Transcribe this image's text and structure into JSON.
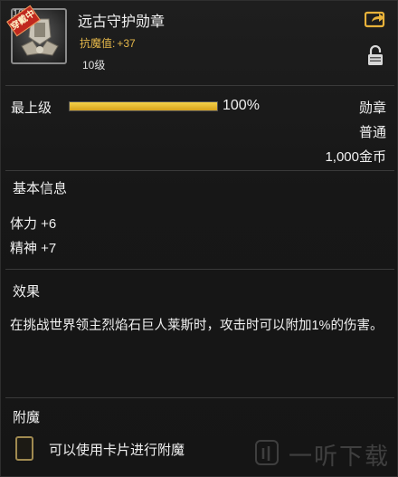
{
  "item": {
    "level_corner": "10",
    "equipped_badge": "穿戴中",
    "name": "远古守护勋章",
    "enchant_label": "抗魔值:",
    "enchant_value": "+37",
    "item_level": "10级",
    "icon": "medal-shield-icon"
  },
  "grade": {
    "label": "最上级",
    "percent_text": "100%",
    "fill_fraction": 1.0
  },
  "meta": {
    "type": "勋章",
    "rarity": "普通",
    "price": "1,000金币"
  },
  "basic_info": {
    "title": "基本信息",
    "stats": [
      "体力 +6",
      "精神 +7"
    ]
  },
  "effect": {
    "title": "效果",
    "text": "在挑战世界领主烈焰石巨人莱斯时，攻击时可以附加1%的伤害。"
  },
  "enchant": {
    "title": "附魔",
    "hint": "可以使用卡片进行附魔"
  },
  "watermark": "一听下载",
  "colors": {
    "gold": "#e6b84a",
    "bar_fill": "#d7a21b",
    "badge_red": "#c0281e",
    "share_gold": "#e8b23a"
  }
}
